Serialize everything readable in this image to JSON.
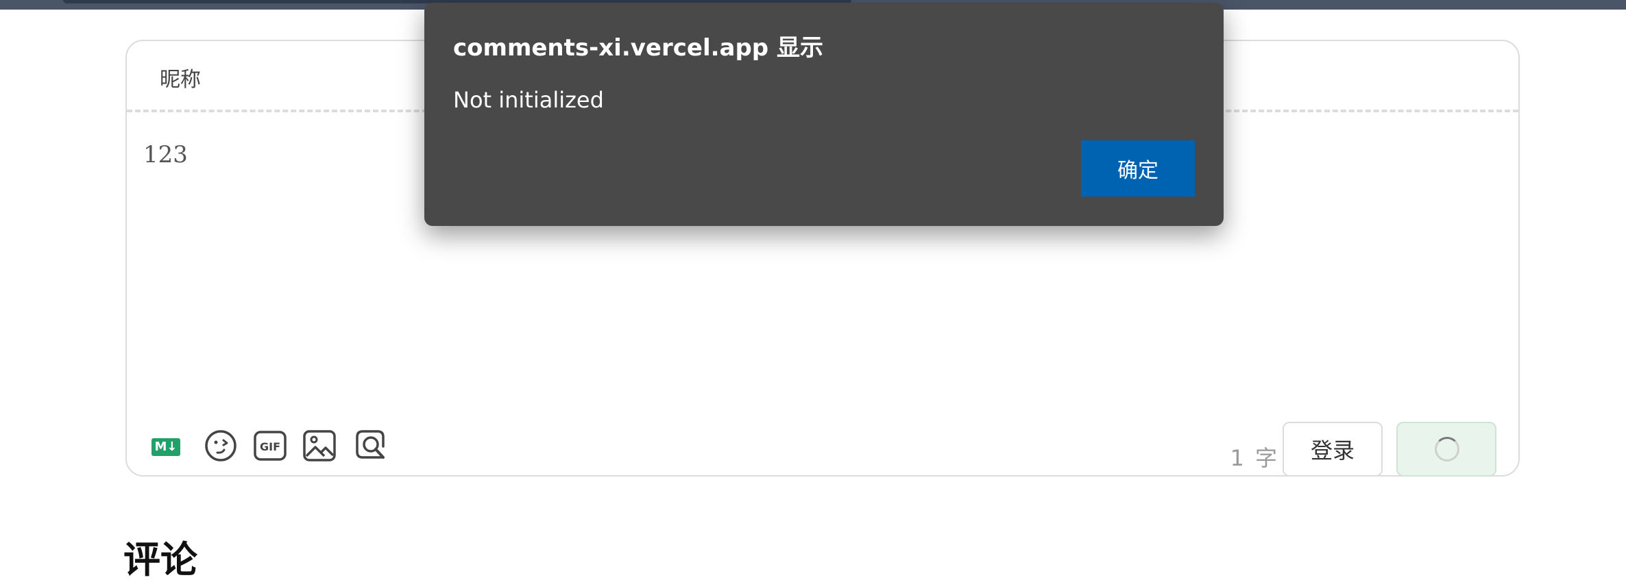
{
  "editor": {
    "nickname_placeholder": "昵称",
    "comment_value": "123",
    "toolbar": {
      "markdown_badge": "M↓",
      "icons": [
        "markdown-icon",
        "emoji-icon",
        "gif-icon",
        "image-icon",
        "preview-icon"
      ]
    },
    "word_count": "1",
    "word_unit": "字",
    "login_label": "登录"
  },
  "section": {
    "title": "评论"
  },
  "dialog": {
    "title": "comments-xi.vercel.app 显示",
    "message": "Not initialized",
    "ok_label": "确定"
  },
  "colors": {
    "dialog_bg": "#494949",
    "ok_button": "#0063b1",
    "markdown_green": "#21a06a",
    "submit_bg": "#e9f4ec"
  }
}
